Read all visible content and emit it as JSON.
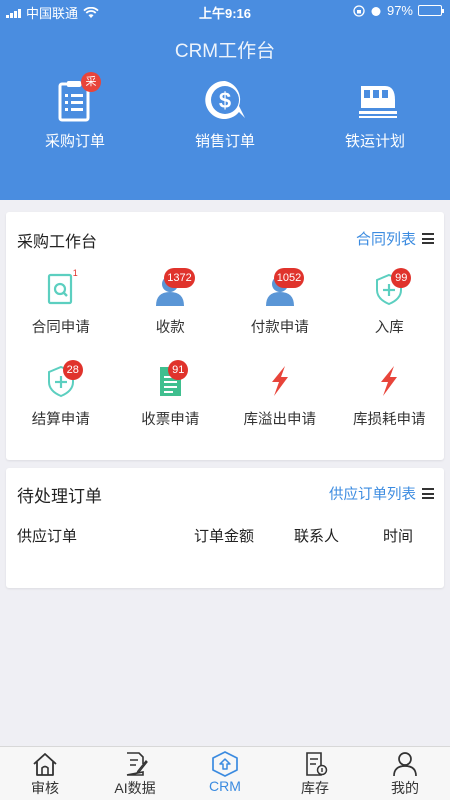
{
  "status_bar": {
    "carrier": "中国联通",
    "time": "上午9:16",
    "battery": "97%",
    "battery_level": 0.97
  },
  "header": {
    "title": "CRM工作台",
    "items": [
      {
        "label": "采购订单",
        "icon": "clipboard-icon",
        "badge": "采"
      },
      {
        "label": "销售订单",
        "icon": "dollar-icon"
      },
      {
        "label": "铁运计划",
        "icon": "train-icon"
      }
    ]
  },
  "purchase_panel": {
    "title": "采购工作台",
    "link": "合同列表",
    "items": [
      {
        "label": "合同申请",
        "icon": "contract-search-icon",
        "badge": "1"
      },
      {
        "label": "收款",
        "icon": "user-icon",
        "badge": "1372"
      },
      {
        "label": "付款申请",
        "icon": "user-icon",
        "badge": "1052"
      },
      {
        "label": "入库",
        "icon": "shield-plus-icon",
        "badge": "99"
      },
      {
        "label": "结算申请",
        "icon": "shield-plus-icon",
        "badge": "28"
      },
      {
        "label": "收票申请",
        "icon": "document-icon",
        "badge": "91"
      },
      {
        "label": "库溢出申请",
        "icon": "lightning-icon"
      },
      {
        "label": "库损耗申请",
        "icon": "lightning-icon"
      }
    ]
  },
  "pending_orders": {
    "title": "待处理订单",
    "link": "供应订单列表",
    "columns": [
      "供应订单",
      "订单金额",
      "联系人",
      "时间"
    ]
  },
  "tabbar": {
    "items": [
      {
        "label": "审核",
        "icon": "home-icon"
      },
      {
        "label": "AI数据",
        "icon": "edit-doc-icon"
      },
      {
        "label": "CRM",
        "icon": "crm-icon",
        "active": true
      },
      {
        "label": "库存",
        "icon": "inventory-icon"
      },
      {
        "label": "我的",
        "icon": "person-icon"
      }
    ]
  },
  "colors": {
    "brand": "#4a8de0",
    "link": "#3b8be0",
    "badge": "#e0332c",
    "teal": "#5ccfc0",
    "person": "#5a96d6",
    "lightning": "#e8443a"
  }
}
